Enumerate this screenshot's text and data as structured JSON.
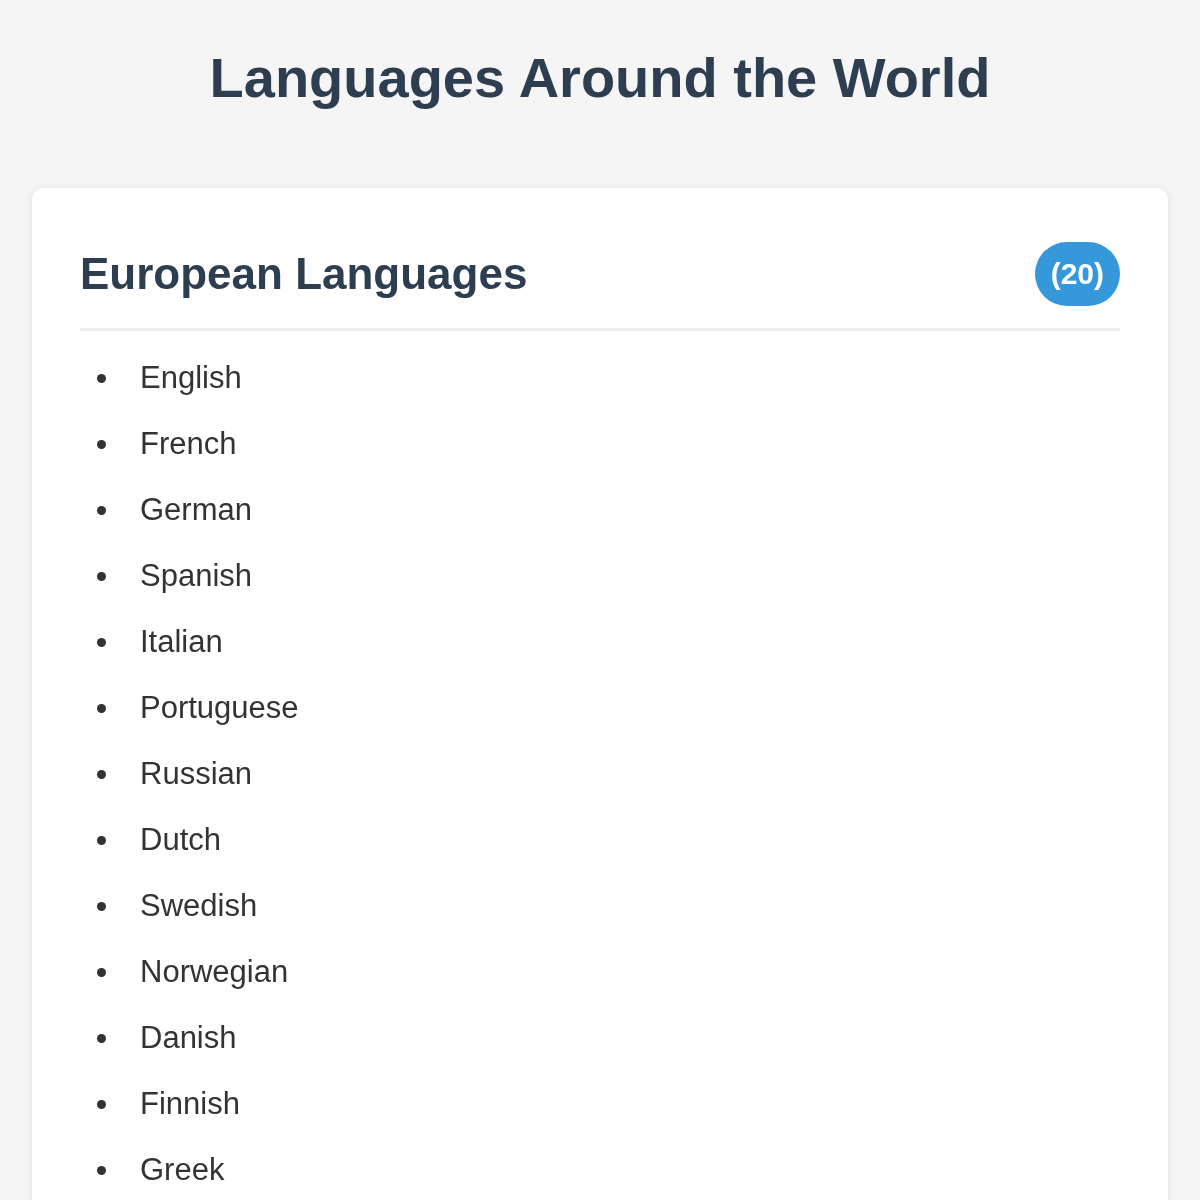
{
  "page": {
    "title": "Languages Around the World"
  },
  "section": {
    "title": "European Languages",
    "count": "(20)",
    "items": [
      "English",
      "French",
      "German",
      "Spanish",
      "Italian",
      "Portuguese",
      "Russian",
      "Dutch",
      "Swedish",
      "Norwegian",
      "Danish",
      "Finnish",
      "Greek"
    ]
  }
}
